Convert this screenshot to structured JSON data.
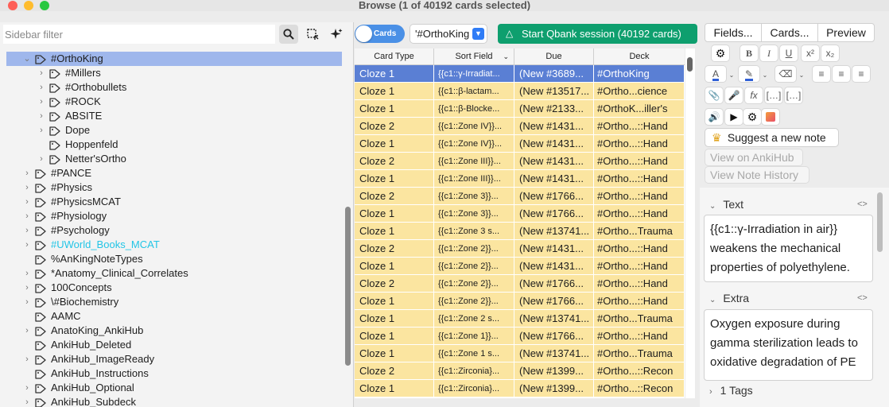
{
  "window": {
    "title": "Browse (1 of 40192 cards selected)"
  },
  "sidebar": {
    "filter_placeholder": "Sidebar filter",
    "items": [
      {
        "label": "#OrthoKing",
        "depth": 0,
        "expander": "open",
        "selected": true
      },
      {
        "label": "#Millers",
        "depth": 1,
        "expander": "closed"
      },
      {
        "label": "#Orthobullets",
        "depth": 1,
        "expander": "closed"
      },
      {
        "label": "#ROCK",
        "depth": 1,
        "expander": "closed"
      },
      {
        "label": "ABSITE",
        "depth": 1,
        "expander": "closed"
      },
      {
        "label": "Dope",
        "depth": 1,
        "expander": "closed"
      },
      {
        "label": "Hoppenfeld",
        "depth": 1,
        "expander": "none"
      },
      {
        "label": "Netter'sOrtho",
        "depth": 1,
        "expander": "closed"
      },
      {
        "label": "#PANCE",
        "depth": 0,
        "expander": "closed"
      },
      {
        "label": "#Physics",
        "depth": 0,
        "expander": "closed"
      },
      {
        "label": "#PhysicsMCAT",
        "depth": 0,
        "expander": "closed"
      },
      {
        "label": "#Physiology",
        "depth": 0,
        "expander": "closed"
      },
      {
        "label": "#Psychology",
        "depth": 0,
        "expander": "closed"
      },
      {
        "label": "#UWorld_Books_MCAT",
        "depth": 0,
        "expander": "closed",
        "color": "#22c5e6"
      },
      {
        "label": "%AnKingNoteTypes",
        "depth": 0,
        "expander": "none"
      },
      {
        "label": "*Anatomy_Clinical_Correlates",
        "depth": 0,
        "expander": "closed"
      },
      {
        "label": "100Concepts",
        "depth": 0,
        "expander": "closed"
      },
      {
        "label": "\\#Biochemistry",
        "depth": 0,
        "expander": "closed"
      },
      {
        "label": "AAMC",
        "depth": 0,
        "expander": "none"
      },
      {
        "label": "AnatoKing_AnkiHub",
        "depth": 0,
        "expander": "closed"
      },
      {
        "label": "AnkiHub_Deleted",
        "depth": 0,
        "expander": "none"
      },
      {
        "label": "AnkiHub_ImageReady",
        "depth": 0,
        "expander": "closed"
      },
      {
        "label": "AnkiHub_Instructions",
        "depth": 0,
        "expander": "none"
      },
      {
        "label": "AnkiHub_Optional",
        "depth": 0,
        "expander": "closed"
      },
      {
        "label": "AnkiHub_Subdeck",
        "depth": 0,
        "expander": "closed"
      }
    ]
  },
  "toolbar": {
    "toggle_label": "Cards",
    "search_value": "'#OrthoKing",
    "qbank_label": "Start Qbank session (40192 cards)"
  },
  "table": {
    "columns": [
      "Card Type",
      "Sort Field",
      "Due",
      "Deck"
    ],
    "rows": [
      [
        "Cloze 1",
        "{{c1::γ-Irradiat...",
        "(New #3689...",
        "#OrthoKing"
      ],
      [
        "Cloze 1",
        "{{c1::β-lactam...",
        "(New #13517...",
        "#Ortho...cience"
      ],
      [
        "Cloze 1",
        "{{c1::β-Blocke...",
        "(New #2133...",
        "#OrthoK...iller's"
      ],
      [
        "Cloze 2",
        "{{c1::Zone IV}}...",
        "(New #1431...",
        "#Ortho...::Hand"
      ],
      [
        "Cloze 1",
        "{{c1::Zone IV}}...",
        "(New #1431...",
        "#Ortho...::Hand"
      ],
      [
        "Cloze 2",
        "{{c1::Zone III}}...",
        "(New #1431...",
        "#Ortho...::Hand"
      ],
      [
        "Cloze 1",
        "{{c1::Zone III}}...",
        "(New #1431...",
        "#Ortho...::Hand"
      ],
      [
        "Cloze 2",
        "{{c1::Zone 3}}...",
        "(New #1766...",
        "#Ortho...::Hand"
      ],
      [
        "Cloze 1",
        "{{c1::Zone 3}}...",
        "(New #1766...",
        "#Ortho...::Hand"
      ],
      [
        "Cloze 1",
        "{{c1::Zone 3 s...",
        "(New #13741...",
        "#Ortho...Trauma"
      ],
      [
        "Cloze 2",
        "{{c1::Zone 2}}...",
        "(New #1431...",
        "#Ortho...::Hand"
      ],
      [
        "Cloze 1",
        "{{c1::Zone 2}}...",
        "(New #1431...",
        "#Ortho...::Hand"
      ],
      [
        "Cloze 2",
        "{{c1::Zone 2}}...",
        "(New #1766...",
        "#Ortho...::Hand"
      ],
      [
        "Cloze 1",
        "{{c1::Zone 2}}...",
        "(New #1766...",
        "#Ortho...::Hand"
      ],
      [
        "Cloze 1",
        "{{c1::Zone 2 s...",
        "(New #13741...",
        "#Ortho...Trauma"
      ],
      [
        "Cloze 1",
        "{{c1::Zone 1}}...",
        "(New #1766...",
        "#Ortho...::Hand"
      ],
      [
        "Cloze 1",
        "{{c1::Zone 1 s...",
        "(New #13741...",
        "#Ortho...Trauma"
      ],
      [
        "Cloze 2",
        "{{c1::Zirconia}...",
        "(New #1399...",
        "#Ortho...::Recon"
      ],
      [
        "Cloze 1",
        "{{c1::Zirconia}...",
        "(New #1399...",
        "#Ortho...::Recon"
      ]
    ]
  },
  "editor": {
    "tabs": [
      "Fields...",
      "Cards...",
      "Preview"
    ],
    "suggest_label": "Suggest a new note",
    "view_ankihub_label": "View on AnkiHub",
    "view_history_label": "View Note History",
    "field1_name": "Text",
    "field1_value": "{{c1::γ-Irradiation in air}} weakens the mechanical properties of polyethylene.",
    "field2_name": "Extra",
    "field2_value": "Oxygen exposure during gamma sterilization leads to oxidative degradation of PE",
    "tags_label": "1 Tags"
  },
  "colors": {
    "selected_row": "#5a7fd4",
    "row_bg": "#fbe5a0",
    "qbank_green": "#0e9f6e",
    "accent_blue": "#2f7cf6",
    "sidebar_selection": "#9fb7ec",
    "uworld_tag": "#22c5e6"
  }
}
